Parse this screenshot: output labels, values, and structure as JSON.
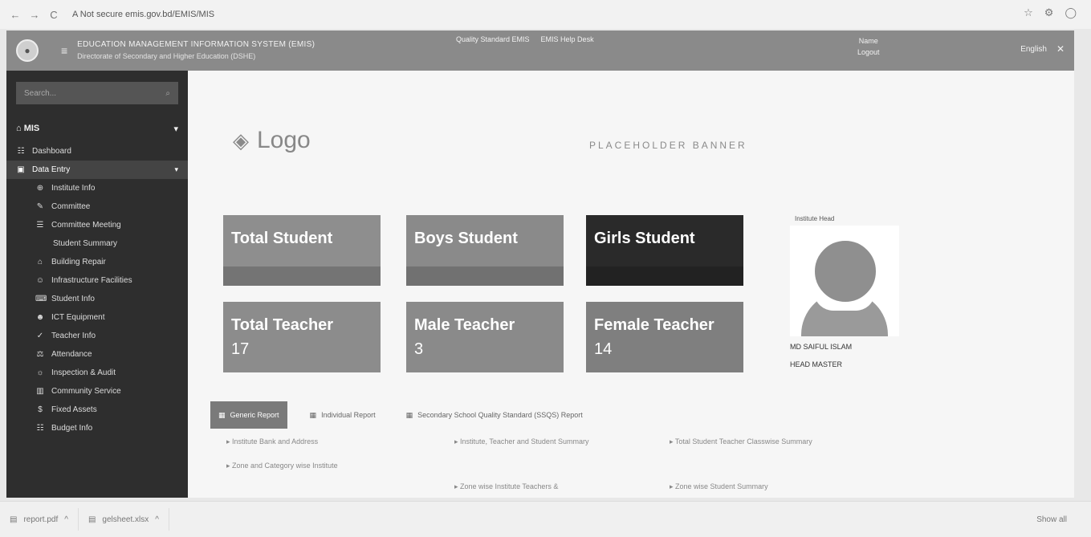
{
  "browser": {
    "back": "←",
    "forward": "→",
    "reload": "C",
    "url": "A  Not secure  emis.gov.bd/EMIS/MIS",
    "icons": [
      "star-icon",
      "extension-icon",
      "profile-icon"
    ]
  },
  "header": {
    "title": "EDUCATION MANAGEMENT INFORMATION SYSTEM (EMIS)",
    "subtitle": "Directorate of Secondary and Higher Education (DSHE)",
    "links": [
      "Quality Standard EMIS",
      "EMIS Help Desk"
    ],
    "user_line1": "Name",
    "user_line2": "Logout",
    "language": "English",
    "expand": "✕"
  },
  "sidebar": {
    "search_placeholder": "Search...",
    "section": "MIS",
    "items": [
      {
        "label": "Dashboard",
        "level": 0
      },
      {
        "label": "Data Entry",
        "level": 0,
        "active": true
      },
      {
        "label": "Institute Info",
        "level": 1
      },
      {
        "label": "Committee",
        "level": 1
      },
      {
        "label": "Committee Meeting",
        "level": 1
      },
      {
        "label": "Student Summary",
        "level": 2
      },
      {
        "label": "Building Repair",
        "level": 1
      },
      {
        "label": "Infrastructure Facilities",
        "level": 1
      },
      {
        "label": "Student Info",
        "level": 1
      },
      {
        "label": "ICT Equipment",
        "level": 1
      },
      {
        "label": "Teacher Info",
        "level": 1
      },
      {
        "label": "Attendance",
        "level": 1
      },
      {
        "label": "Inspection & Audit",
        "level": 1
      },
      {
        "label": "Community Service",
        "level": 1
      },
      {
        "label": "Fixed Assets",
        "level": 1
      },
      {
        "label": "Budget Info",
        "level": 1
      }
    ]
  },
  "main": {
    "logo_text": "Logo",
    "placeholder_banner": "PLACEHOLDER BANNER",
    "cards": [
      {
        "label": "Total Student",
        "value": "",
        "color": "#8e8e8e"
      },
      {
        "label": "Boys Student",
        "value": "",
        "color": "#8a8a8a"
      },
      {
        "label": "Girls Student",
        "value": "",
        "color": "#2a2a2a"
      },
      {
        "label": "Total Teacher",
        "value": "17",
        "color": "#8c8c8c"
      },
      {
        "label": "Male Teacher",
        "value": "3",
        "color": "#8a8a8a"
      },
      {
        "label": "Female Teacher",
        "value": "14",
        "color": "#7f7f7f"
      }
    ],
    "profile": {
      "caption": "Institute Head",
      "name": "MD SAIFUL ISLAM",
      "role": "HEAD MASTER"
    },
    "report_tabs": [
      {
        "label": "Generic Report",
        "active": true
      },
      {
        "label": "Individual Report",
        "active": false
      },
      {
        "label": "Secondary School Quality Standard (SSQS) Report",
        "active": false
      }
    ],
    "report_links": [
      "Institute Bank and Address",
      "Institute, Teacher and Student Summary",
      "Total Student Teacher Classwise Summary",
      "Zone and Category wise Institute",
      "Zone wise Institute Teachers &",
      "Zone wise Student Summary"
    ]
  },
  "downloads": {
    "items": [
      "report.pdf",
      "gelsheet.xlsx"
    ],
    "show_all": "Show all"
  }
}
